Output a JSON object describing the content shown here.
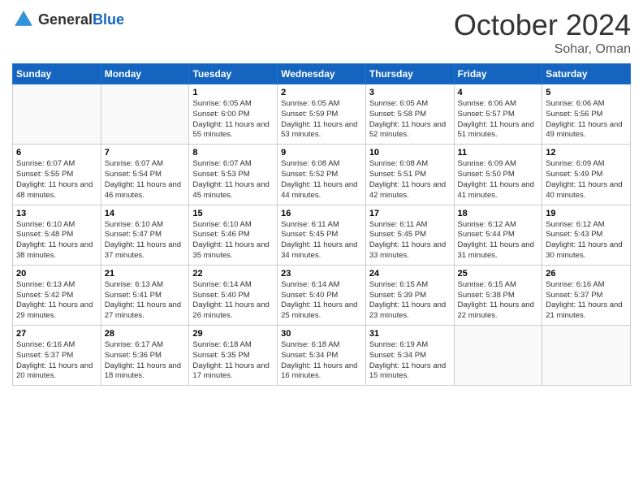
{
  "logo": {
    "general": "General",
    "blue": "Blue"
  },
  "header": {
    "month": "October 2024",
    "location": "Sohar, Oman"
  },
  "weekdays": [
    "Sunday",
    "Monday",
    "Tuesday",
    "Wednesday",
    "Thursday",
    "Friday",
    "Saturday"
  ],
  "weeks": [
    [
      {
        "day": "",
        "empty": true
      },
      {
        "day": "",
        "empty": true
      },
      {
        "day": "1",
        "sunrise": "6:05 AM",
        "sunset": "6:00 PM",
        "daylight": "11 hours and 55 minutes."
      },
      {
        "day": "2",
        "sunrise": "6:05 AM",
        "sunset": "5:59 PM",
        "daylight": "11 hours and 53 minutes."
      },
      {
        "day": "3",
        "sunrise": "6:05 AM",
        "sunset": "5:58 PM",
        "daylight": "11 hours and 52 minutes."
      },
      {
        "day": "4",
        "sunrise": "6:06 AM",
        "sunset": "5:57 PM",
        "daylight": "11 hours and 51 minutes."
      },
      {
        "day": "5",
        "sunrise": "6:06 AM",
        "sunset": "5:56 PM",
        "daylight": "11 hours and 49 minutes."
      }
    ],
    [
      {
        "day": "6",
        "sunrise": "6:07 AM",
        "sunset": "5:55 PM",
        "daylight": "11 hours and 48 minutes."
      },
      {
        "day": "7",
        "sunrise": "6:07 AM",
        "sunset": "5:54 PM",
        "daylight": "11 hours and 46 minutes."
      },
      {
        "day": "8",
        "sunrise": "6:07 AM",
        "sunset": "5:53 PM",
        "daylight": "11 hours and 45 minutes."
      },
      {
        "day": "9",
        "sunrise": "6:08 AM",
        "sunset": "5:52 PM",
        "daylight": "11 hours and 44 minutes."
      },
      {
        "day": "10",
        "sunrise": "6:08 AM",
        "sunset": "5:51 PM",
        "daylight": "11 hours and 42 minutes."
      },
      {
        "day": "11",
        "sunrise": "6:09 AM",
        "sunset": "5:50 PM",
        "daylight": "11 hours and 41 minutes."
      },
      {
        "day": "12",
        "sunrise": "6:09 AM",
        "sunset": "5:49 PM",
        "daylight": "11 hours and 40 minutes."
      }
    ],
    [
      {
        "day": "13",
        "sunrise": "6:10 AM",
        "sunset": "5:48 PM",
        "daylight": "11 hours and 38 minutes."
      },
      {
        "day": "14",
        "sunrise": "6:10 AM",
        "sunset": "5:47 PM",
        "daylight": "11 hours and 37 minutes."
      },
      {
        "day": "15",
        "sunrise": "6:10 AM",
        "sunset": "5:46 PM",
        "daylight": "11 hours and 35 minutes."
      },
      {
        "day": "16",
        "sunrise": "6:11 AM",
        "sunset": "5:45 PM",
        "daylight": "11 hours and 34 minutes."
      },
      {
        "day": "17",
        "sunrise": "6:11 AM",
        "sunset": "5:45 PM",
        "daylight": "11 hours and 33 minutes."
      },
      {
        "day": "18",
        "sunrise": "6:12 AM",
        "sunset": "5:44 PM",
        "daylight": "11 hours and 31 minutes."
      },
      {
        "day": "19",
        "sunrise": "6:12 AM",
        "sunset": "5:43 PM",
        "daylight": "11 hours and 30 minutes."
      }
    ],
    [
      {
        "day": "20",
        "sunrise": "6:13 AM",
        "sunset": "5:42 PM",
        "daylight": "11 hours and 29 minutes."
      },
      {
        "day": "21",
        "sunrise": "6:13 AM",
        "sunset": "5:41 PM",
        "daylight": "11 hours and 27 minutes."
      },
      {
        "day": "22",
        "sunrise": "6:14 AM",
        "sunset": "5:40 PM",
        "daylight": "11 hours and 26 minutes."
      },
      {
        "day": "23",
        "sunrise": "6:14 AM",
        "sunset": "5:40 PM",
        "daylight": "11 hours and 25 minutes."
      },
      {
        "day": "24",
        "sunrise": "6:15 AM",
        "sunset": "5:39 PM",
        "daylight": "11 hours and 23 minutes."
      },
      {
        "day": "25",
        "sunrise": "6:15 AM",
        "sunset": "5:38 PM",
        "daylight": "11 hours and 22 minutes."
      },
      {
        "day": "26",
        "sunrise": "6:16 AM",
        "sunset": "5:37 PM",
        "daylight": "11 hours and 21 minutes."
      }
    ],
    [
      {
        "day": "27",
        "sunrise": "6:16 AM",
        "sunset": "5:37 PM",
        "daylight": "11 hours and 20 minutes."
      },
      {
        "day": "28",
        "sunrise": "6:17 AM",
        "sunset": "5:36 PM",
        "daylight": "11 hours and 18 minutes."
      },
      {
        "day": "29",
        "sunrise": "6:18 AM",
        "sunset": "5:35 PM",
        "daylight": "11 hours and 17 minutes."
      },
      {
        "day": "30",
        "sunrise": "6:18 AM",
        "sunset": "5:34 PM",
        "daylight": "11 hours and 16 minutes."
      },
      {
        "day": "31",
        "sunrise": "6:19 AM",
        "sunset": "5:34 PM",
        "daylight": "11 hours and 15 minutes."
      },
      {
        "day": "",
        "empty": true
      },
      {
        "day": "",
        "empty": true
      }
    ]
  ],
  "labels": {
    "sunrise": "Sunrise:",
    "sunset": "Sunset:",
    "daylight": "Daylight:"
  }
}
